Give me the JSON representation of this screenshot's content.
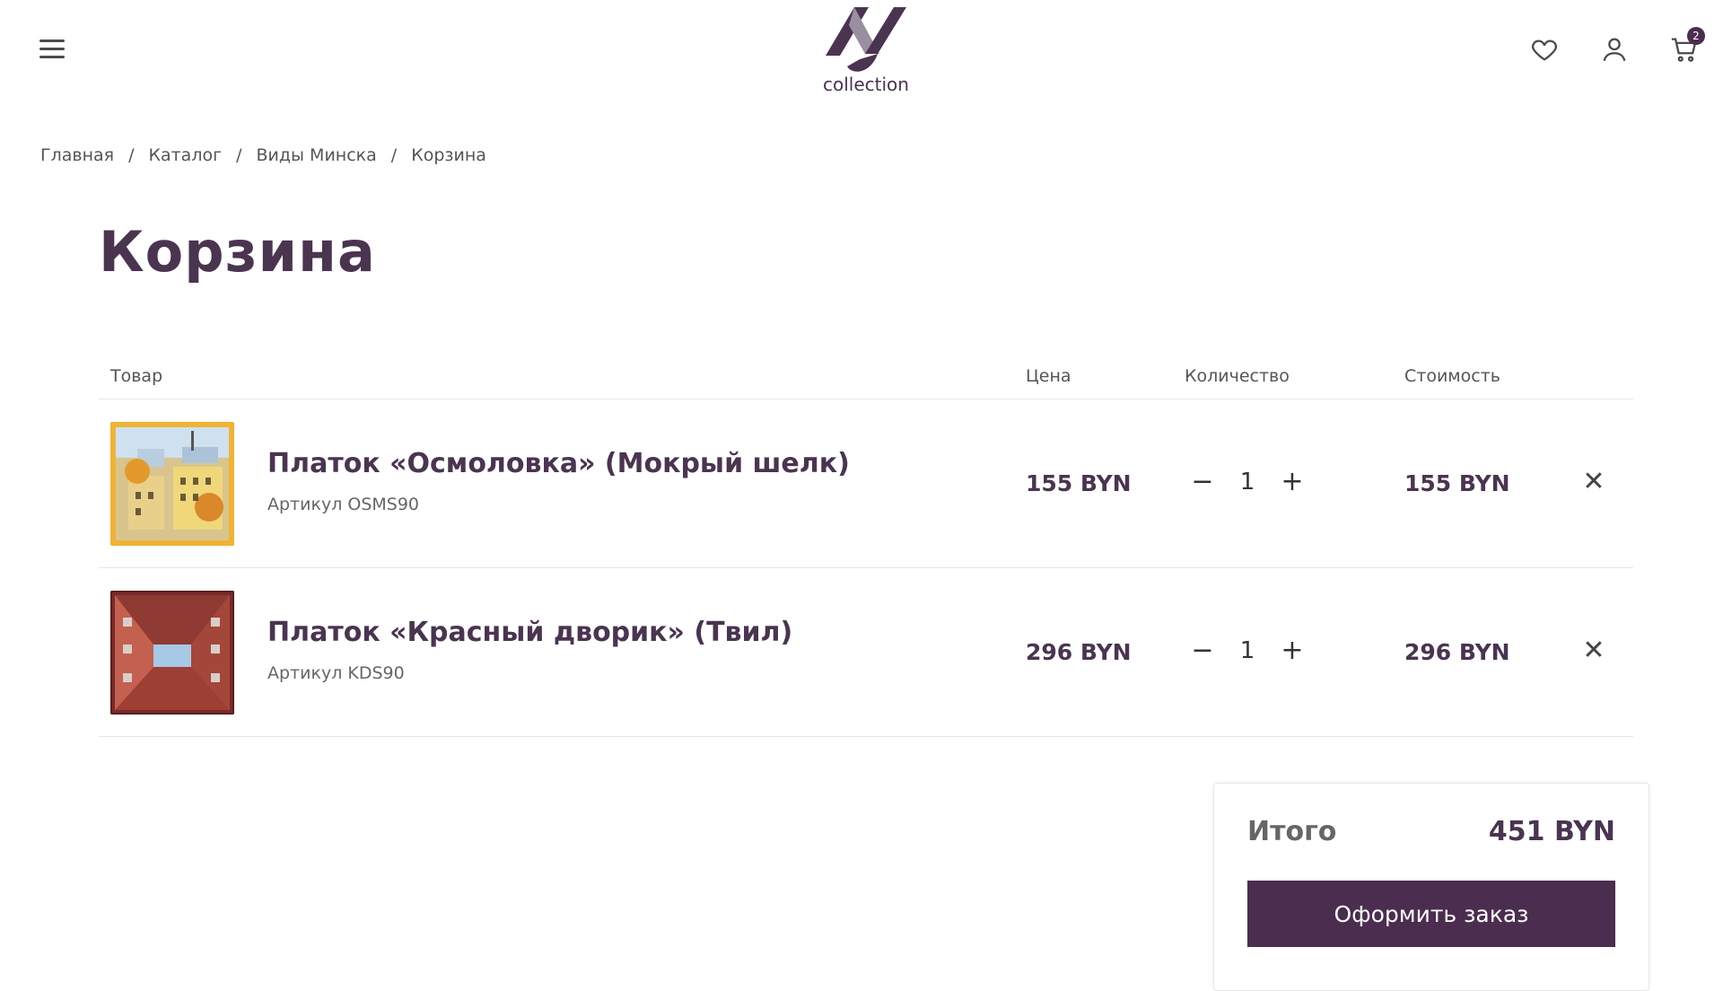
{
  "header": {
    "logo_text": "collection",
    "cart_count": "2"
  },
  "breadcrumb": {
    "items": [
      "Главная",
      "Каталог",
      "Виды Минска",
      "Корзина"
    ],
    "separator": "/"
  },
  "page_title": "Корзина",
  "table": {
    "headers": {
      "product": "Товар",
      "price": "Цена",
      "quantity": "Количество",
      "cost": "Стоимость"
    },
    "rows": [
      {
        "name": "Платок «Осмоловка» (Мокрый шелк)",
        "sku": "Артикул OSMS90",
        "price": "155 BYN",
        "quantity": "1",
        "cost": "155 BYN"
      },
      {
        "name": "Платок «Красный дворик» (Твил)",
        "sku": "Артикул KDS90",
        "price": "296 BYN",
        "quantity": "1",
        "cost": "296 BYN"
      }
    ],
    "minus_symbol": "−",
    "plus_symbol": "+",
    "remove_symbol": "✕"
  },
  "summary": {
    "label": "Итого",
    "total": "451 BYN",
    "checkout_label": "Оформить заказ"
  },
  "colors": {
    "accent": "#4b2d4f",
    "text": "#4a3450"
  },
  "icons": [
    "menu-icon",
    "heart-icon",
    "user-icon",
    "cart-icon",
    "close-icon"
  ]
}
